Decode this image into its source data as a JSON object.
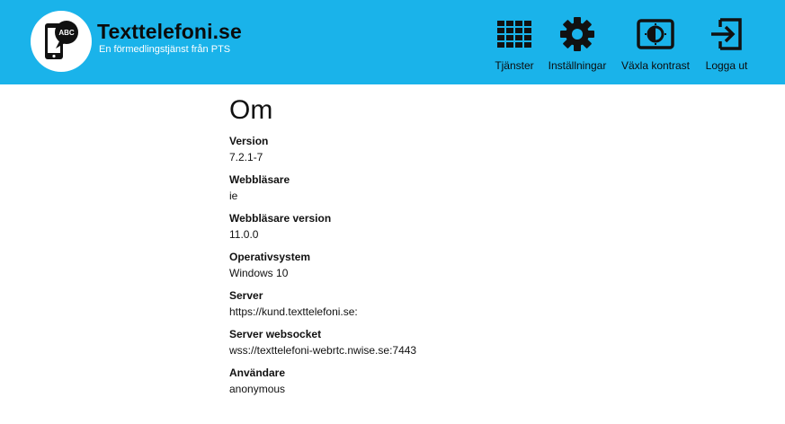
{
  "header": {
    "brand_title": "Texttelefoni.se",
    "brand_subtitle": "En förmedlingstjänst från PTS",
    "logo_badge_text": "ABC",
    "background_color": "#1ab3ea",
    "nav": [
      {
        "label": "Tjänster",
        "icon": "grid-icon"
      },
      {
        "label": "Inställningar",
        "icon": "gear-icon"
      },
      {
        "label": "Växla kontrast",
        "icon": "contrast-icon"
      },
      {
        "label": "Logga ut",
        "icon": "logout-icon"
      }
    ]
  },
  "main": {
    "title": "Om",
    "fields": [
      {
        "label": "Version",
        "value": "7.2.1-7"
      },
      {
        "label": "Webbläsare",
        "value": "ie"
      },
      {
        "label": "Webbläsare version",
        "value": "11.0.0"
      },
      {
        "label": "Operativsystem",
        "value": "Windows 10"
      },
      {
        "label": "Server",
        "value": "https://kund.texttelefoni.se:"
      },
      {
        "label": "Server websocket",
        "value": "wss://texttelefoni-webrtc.nwise.se:7443"
      },
      {
        "label": "Användare",
        "value": "anonymous"
      }
    ]
  }
}
